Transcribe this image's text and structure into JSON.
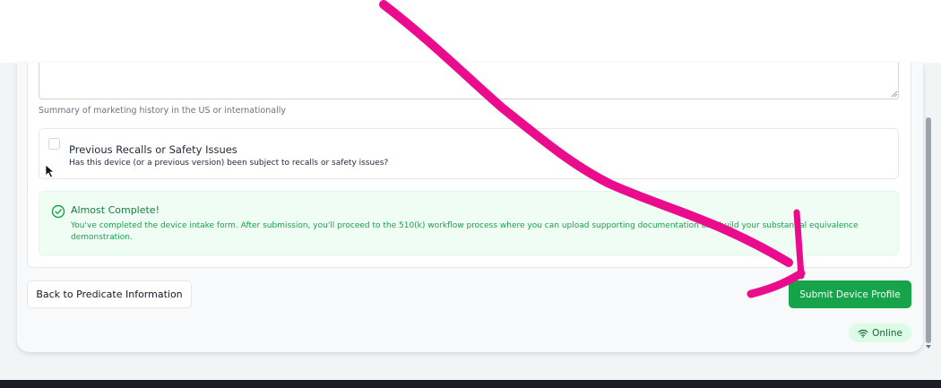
{
  "form": {
    "marketing_helper": "Summary of marketing history in the US or internationally",
    "recalls": {
      "title": "Previous Recalls or Safety Issues",
      "description": "Has this device (or a previous version) been subject to recalls or safety issues?",
      "checked": false
    }
  },
  "alert": {
    "title": "Almost Complete!",
    "message": "You've completed the device intake form. After submission, you'll proceed to the 510(k) workflow process where you can upload supporting documentation and build your substantial equivalence demonstration."
  },
  "actions": {
    "back_label": "Back to Predicate Information",
    "submit_label": "Submit Device Profile"
  },
  "status": {
    "online_label": "Online"
  },
  "colors": {
    "accent_green": "#16a34a",
    "annotation_magenta": "#ea0c8c"
  },
  "icons": {
    "alert": "check-circle-icon",
    "status": "wifi-icon",
    "cursor": "mouse-pointer-icon"
  }
}
